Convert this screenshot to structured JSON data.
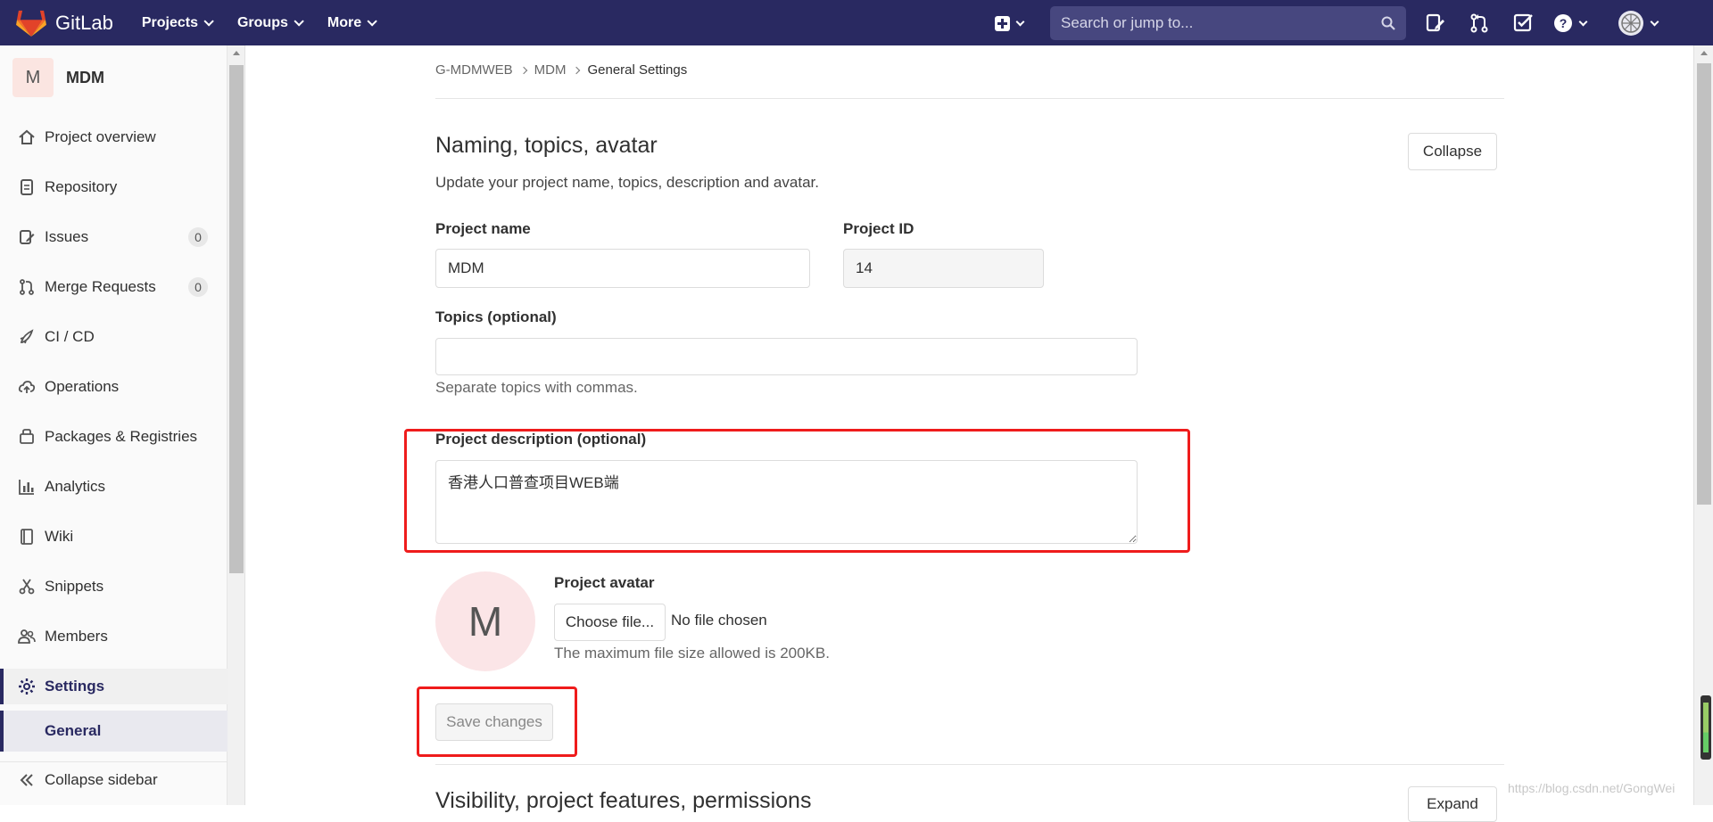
{
  "navbar": {
    "brand": "GitLab",
    "menu": [
      {
        "label": "Projects"
      },
      {
        "label": "Groups"
      },
      {
        "label": "More"
      }
    ],
    "search_placeholder": "Search or jump to..."
  },
  "sidebar": {
    "project_initial": "M",
    "project_name": "MDM",
    "items": [
      {
        "label": "Project overview",
        "icon": "home-icon"
      },
      {
        "label": "Repository",
        "icon": "doc-icon"
      },
      {
        "label": "Issues",
        "icon": "issues-icon",
        "badge": "0"
      },
      {
        "label": "Merge Requests",
        "icon": "merge-request-icon",
        "badge": "0"
      },
      {
        "label": "CI / CD",
        "icon": "rocket-icon"
      },
      {
        "label": "Operations",
        "icon": "cloud-icon"
      },
      {
        "label": "Packages & Registries",
        "icon": "package-icon"
      },
      {
        "label": "Analytics",
        "icon": "chart-icon"
      },
      {
        "label": "Wiki",
        "icon": "book-icon"
      },
      {
        "label": "Snippets",
        "icon": "scissors-icon"
      },
      {
        "label": "Members",
        "icon": "users-icon"
      },
      {
        "label": "Settings",
        "icon": "gear-icon"
      }
    ],
    "sub_item": "General",
    "collapse_label": "Collapse sidebar"
  },
  "breadcrumb": [
    "G-MDMWEB",
    "MDM",
    "General Settings"
  ],
  "section": {
    "title": "Naming, topics, avatar",
    "description": "Update your project name, topics, description and avatar.",
    "collapse_button": "Collapse",
    "project_name_label": "Project name",
    "project_name_value": "MDM",
    "project_id_label": "Project ID",
    "project_id_value": "14",
    "topics_label": "Topics (optional)",
    "topics_value": "",
    "topics_help": "Separate topics with commas.",
    "description_label": "Project description (optional)",
    "description_value": "香港人口普查项目WEB端",
    "avatar_initial": "M",
    "avatar_label": "Project avatar",
    "choose_file_button": "Choose file...",
    "no_file_text": "No file chosen",
    "avatar_help": "The maximum file size allowed is 200KB.",
    "save_button": "Save changes"
  },
  "next_section": {
    "title": "Visibility, project features, permissions",
    "button": "Expand"
  },
  "watermark": "https://blog.csdn.net/GongWei",
  "colors": {
    "navbar_bg": "#292961",
    "highlight_box": "#ef1c1c",
    "accent": "#292961"
  }
}
